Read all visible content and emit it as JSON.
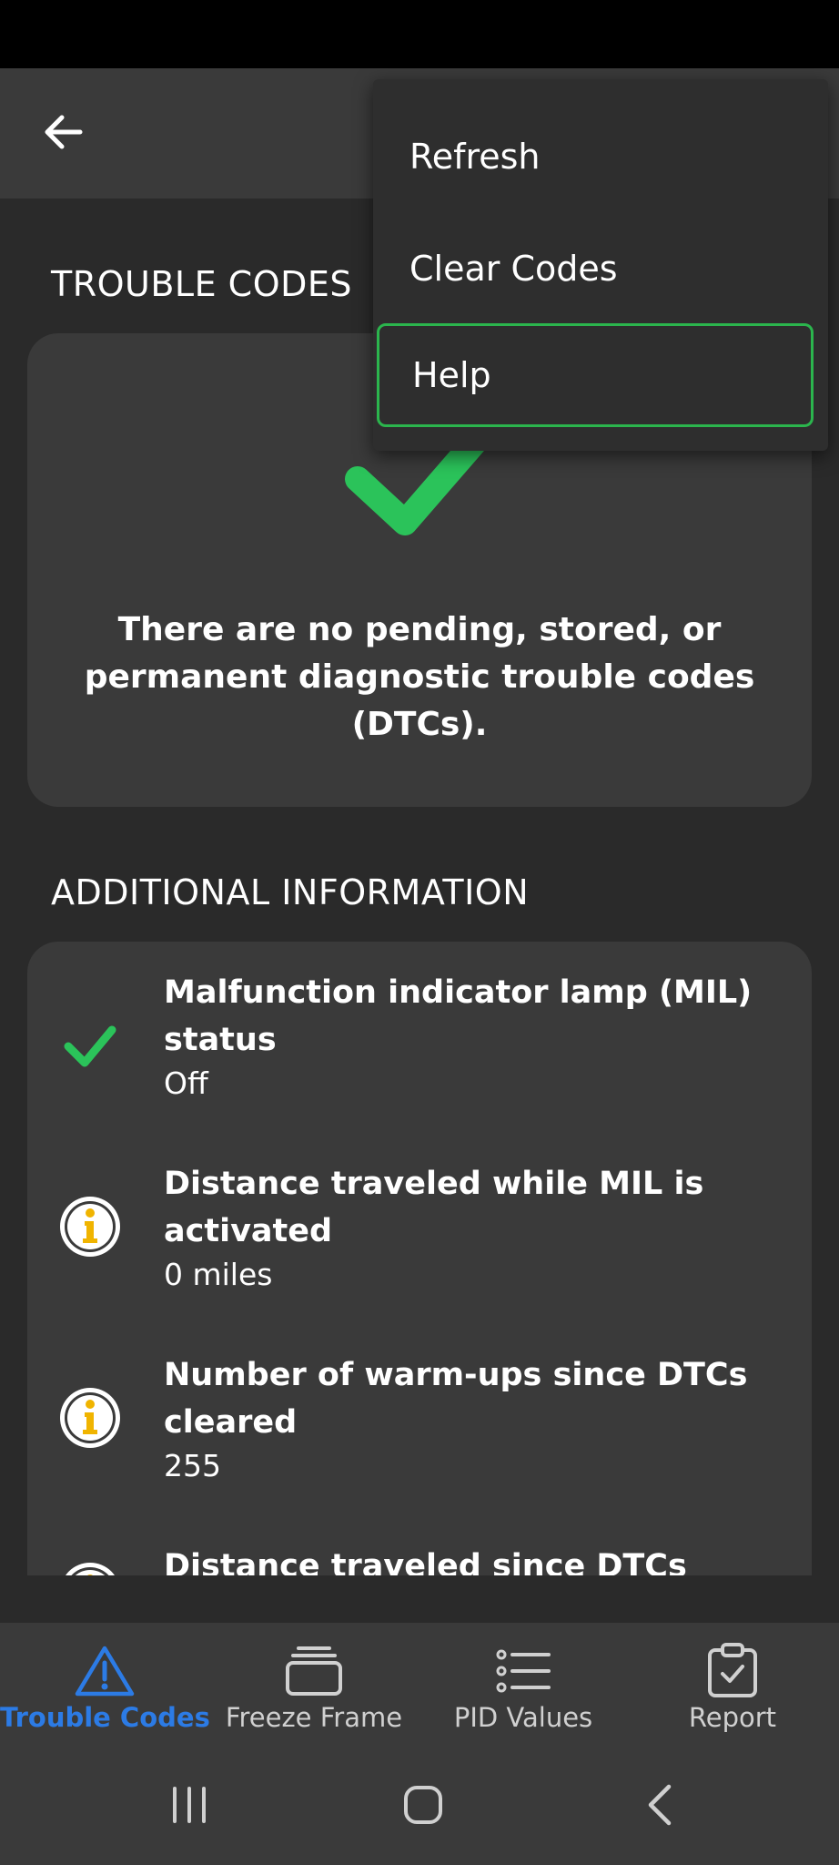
{
  "app_bar": {
    "back_icon": "arrow-left-icon"
  },
  "sections": {
    "trouble_codes": "TROUBLE CODES",
    "additional_info": "ADDITIONAL INFORMATION"
  },
  "dtc_card": {
    "icon": "check-icon",
    "message": "There are no pending, stored, or permanent diagnostic trouble codes (DTCs)."
  },
  "info_items": [
    {
      "icon": "check-icon",
      "title": "Malfunction indicator lamp (MIL) status",
      "value": "Off"
    },
    {
      "icon": "info-icon",
      "title": "Distance traveled while MIL is activated",
      "value": "0 miles"
    },
    {
      "icon": "info-icon",
      "title": "Number of warm-ups since DTCs cleared",
      "value": "255"
    },
    {
      "icon": "info-icon",
      "title": "Distance traveled since DTCs cleared",
      "value": ""
    }
  ],
  "bottom_nav": [
    {
      "label": "Trouble Codes",
      "icon": "warning-triangle-icon",
      "active": true
    },
    {
      "label": "Freeze Frame",
      "icon": "freeze-frame-icon",
      "active": false
    },
    {
      "label": "PID Values",
      "icon": "list-icon",
      "active": false
    },
    {
      "label": "Report",
      "icon": "clipboard-check-icon",
      "active": false
    }
  ],
  "overflow_menu": {
    "items": [
      "Refresh",
      "Clear Codes",
      "Help"
    ],
    "focused_item": "Help"
  },
  "colors": {
    "accent_green": "#2bc35a",
    "info_yellow": "#f0b400",
    "active_blue": "#2c7be5",
    "surface": "#3a3a3a",
    "background": "#2a2a2a"
  }
}
